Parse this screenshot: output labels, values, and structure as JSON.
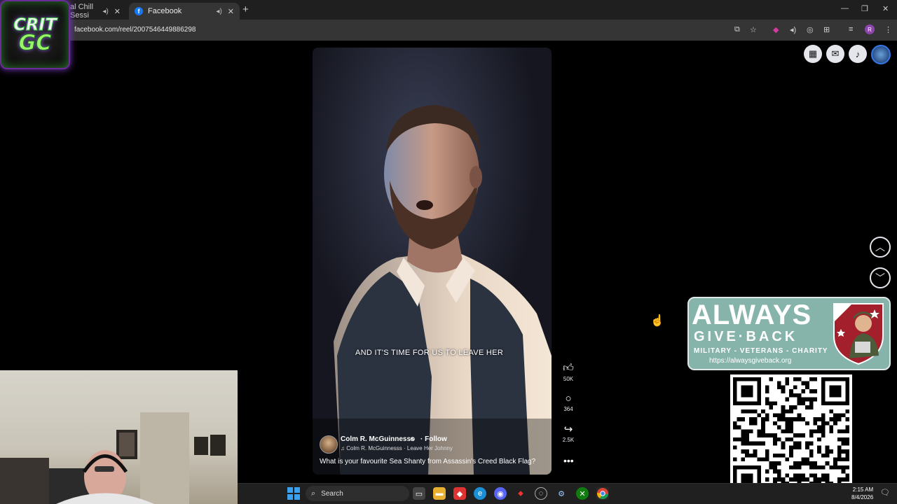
{
  "browser": {
    "tabs": [
      {
        "label": "al Chill Sessi",
        "active": false
      },
      {
        "label": "Facebook",
        "active": true
      }
    ],
    "url": "facebook.com/reel/2007546449886298",
    "profile_initial": "R"
  },
  "overlay_logo": {
    "line1": "CRIT",
    "line2": "GC"
  },
  "reel": {
    "caption": "AND IT'S TIME FOR US TO LEAVE HER",
    "author": "Colm R. McGuinnesss",
    "follow": "· Follow",
    "song": "Colm R. McGuinnesss · Leave Her Johnny",
    "description": "What is your favourite Sea Shanty from Assassin's Creed Black Flag?",
    "likes": "50K",
    "comments": "364",
    "shares": "2.5K"
  },
  "banner": {
    "title_line1": "ALWAYS",
    "title_line2": "GIVE·BACK",
    "tagline": "MILITARY - VETERANS - CHARITY",
    "url": "https://alwaysgiveback.org"
  },
  "taskbar": {
    "search_placeholder": "Search",
    "time": "2:15 AM",
    "date": "8/4/2026"
  },
  "icons": {
    "speaker": "🔊",
    "close": "✕",
    "plus": "+",
    "like": "👍",
    "comment": "○",
    "share": "↪",
    "more": "•••",
    "up": "︿",
    "down": "﹀",
    "cursor": "☝",
    "search": "⌕",
    "grid": "▦",
    "messenger": "✉",
    "bell": "🔔"
  },
  "colors": {
    "facebook_blue": "#1877f2",
    "banner_teal": "#87b4aa",
    "logo_green": "#3ccf3c",
    "logo_purple": "#7c3cc7"
  }
}
